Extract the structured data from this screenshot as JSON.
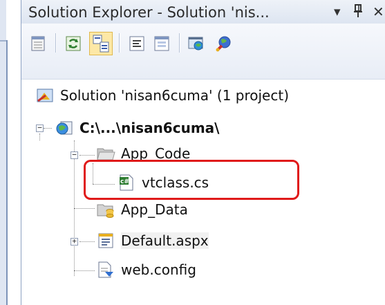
{
  "window": {
    "title": "Solution Explorer - Solution 'nis...",
    "buttons": {
      "dropdown_icon": "dropdown-arrow",
      "pin_icon": "pin",
      "close_icon": "close"
    }
  },
  "toolbar": {
    "buttons": [
      {
        "name": "properties-icon",
        "active": false
      },
      {
        "name": "refresh-icon",
        "active": false
      },
      {
        "name": "nest-related-files-icon",
        "active": true
      },
      {
        "name": "view-code-icon",
        "active": false
      },
      {
        "name": "view-designer-icon",
        "active": false
      },
      {
        "name": "copy-website-icon",
        "active": false
      },
      {
        "name": "asp-net-configuration-icon",
        "active": false
      }
    ]
  },
  "tree": {
    "solution": {
      "label": "Solution 'nisan6cuma' (1 project)"
    },
    "project": {
      "label": "C:\\...\\nisan6cuma\\"
    },
    "app_code": {
      "label": "App_Code"
    },
    "vtclass": {
      "label": "vtclass.cs",
      "highlighted": true
    },
    "app_data": {
      "label": "App_Data"
    },
    "default_aspx": {
      "label": "Default.aspx"
    },
    "web_config": {
      "label": "web.config"
    }
  },
  "colors": {
    "highlight_border": "#e01a1a",
    "active_button": "#fde8a6"
  }
}
